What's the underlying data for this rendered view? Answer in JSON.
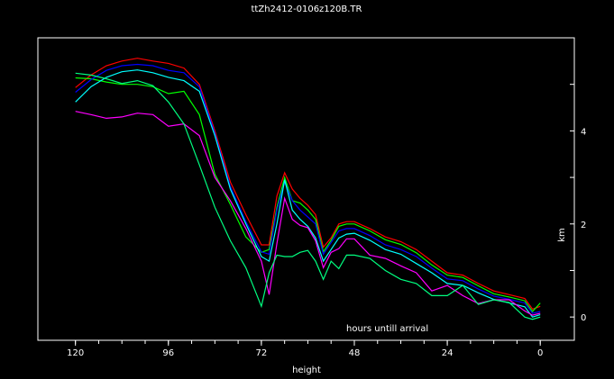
{
  "chart_data": {
    "type": "line",
    "title": "ttZh2412-0106z120B.TR",
    "xlabel": "height",
    "ylabel": "km",
    "annotation": "hours untill arrival",
    "xlim": [
      129.7,
      -8.8
    ],
    "ylim": [
      -0.5,
      6.0
    ],
    "xticks": [
      120,
      96,
      72,
      48,
      24,
      0
    ],
    "xtick_labels": [
      "120",
      "96",
      "72",
      "48",
      "24",
      "0"
    ],
    "x_minor_step": 6,
    "yticks": [
      0,
      2,
      4
    ],
    "ytick_labels": [
      "0",
      "2",
      "4"
    ],
    "y_minor_step": 1,
    "grid": false,
    "x": [
      120,
      116,
      112,
      108,
      104,
      100,
      96,
      92,
      88,
      84,
      80,
      76,
      72,
      70,
      68,
      66,
      64,
      62,
      60,
      58,
      56,
      54,
      52,
      50,
      48,
      44,
      40,
      36,
      32,
      28,
      24,
      20,
      16,
      12,
      8,
      4,
      2,
      0
    ],
    "series": [
      {
        "name": "red",
        "color": "#ff0000",
        "values": [
          4.93,
          5.2,
          5.4,
          5.5,
          5.56,
          5.5,
          5.45,
          5.35,
          5.0,
          4.0,
          2.9,
          2.2,
          1.55,
          1.55,
          2.6,
          3.1,
          2.75,
          2.55,
          2.4,
          2.2,
          1.5,
          1.7,
          2.0,
          2.05,
          2.05,
          1.9,
          1.72,
          1.62,
          1.45,
          1.2,
          0.95,
          0.9,
          0.72,
          0.56,
          0.48,
          0.4,
          0.17,
          0.23
        ]
      },
      {
        "name": "green",
        "color": "#00ff00",
        "values": [
          5.14,
          5.12,
          5.05,
          5.0,
          5.0,
          4.95,
          4.8,
          4.85,
          4.35,
          3.07,
          2.42,
          1.72,
          1.39,
          1.45,
          2.36,
          3.0,
          2.5,
          2.45,
          2.3,
          2.1,
          1.4,
          1.65,
          1.95,
          2.0,
          2.0,
          1.85,
          1.66,
          1.56,
          1.38,
          1.12,
          0.9,
          0.85,
          0.67,
          0.5,
          0.43,
          0.35,
          0.12,
          0.3
        ]
      },
      {
        "name": "blue",
        "color": "#0000ff",
        "values": [
          4.83,
          5.1,
          5.3,
          5.4,
          5.43,
          5.4,
          5.3,
          5.25,
          4.95,
          3.95,
          2.8,
          2.05,
          1.4,
          1.35,
          2.3,
          2.9,
          2.5,
          2.3,
          2.15,
          2.0,
          1.35,
          1.6,
          1.85,
          1.9,
          1.9,
          1.75,
          1.55,
          1.45,
          1.3,
          1.05,
          0.82,
          0.78,
          0.6,
          0.45,
          0.38,
          0.3,
          0.08,
          0.12
        ]
      },
      {
        "name": "cyan",
        "color": "#00ffff",
        "values": [
          4.62,
          4.95,
          5.15,
          5.27,
          5.31,
          5.25,
          5.15,
          5.08,
          4.85,
          3.9,
          2.75,
          2.0,
          1.3,
          1.2,
          2.0,
          2.95,
          2.3,
          2.1,
          1.95,
          1.7,
          1.2,
          1.45,
          1.7,
          1.78,
          1.8,
          1.65,
          1.45,
          1.35,
          1.15,
          0.95,
          0.72,
          0.68,
          0.52,
          0.38,
          0.3,
          0.22,
          0.0,
          0.05
        ]
      },
      {
        "name": "magenta",
        "color": "#ff00ff",
        "values": [
          4.42,
          4.35,
          4.27,
          4.3,
          4.38,
          4.35,
          4.1,
          4.15,
          3.9,
          3.0,
          2.5,
          1.9,
          1.2,
          0.48,
          1.58,
          2.55,
          2.1,
          1.97,
          1.92,
          1.64,
          1.06,
          1.39,
          1.47,
          1.68,
          1.68,
          1.33,
          1.26,
          1.1,
          0.95,
          0.56,
          0.68,
          0.46,
          0.29,
          0.37,
          0.37,
          0.13,
          0.04,
          0.08
        ]
      },
      {
        "name": "spring-green",
        "color": "#00ff80",
        "values": [
          5.24,
          5.2,
          5.12,
          5.02,
          5.08,
          4.97,
          4.62,
          4.15,
          3.27,
          2.36,
          1.64,
          1.06,
          0.23,
          0.95,
          1.33,
          1.3,
          1.3,
          1.39,
          1.43,
          1.2,
          0.81,
          1.2,
          1.04,
          1.33,
          1.33,
          1.26,
          1.0,
          0.81,
          0.72,
          0.46,
          0.46,
          0.68,
          0.27,
          0.37,
          0.31,
          0.0,
          -0.05,
          0.0
        ]
      }
    ]
  }
}
